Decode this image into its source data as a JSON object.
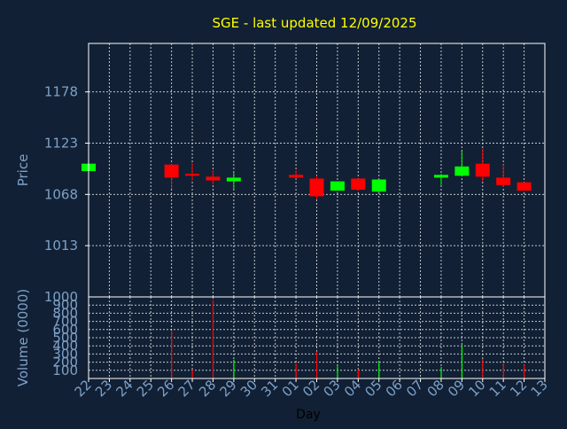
{
  "title": "SGE - last updated 12/09/2025",
  "colors": {
    "background": "#112034",
    "title": "#ffff00",
    "axis_text": "#7ea0c8",
    "xlabel": "#000000",
    "grid": "#ffffff",
    "frame": "#ffffff",
    "up": "#00ff00",
    "down": "#ff0000"
  },
  "chart_data": [
    {
      "type": "candlestick",
      "title": "SGE - last updated 12/09/2025",
      "ylabel": "Price",
      "ylim": [
        958,
        1230
      ],
      "yticks": [
        1013,
        1068,
        1123,
        1178
      ],
      "grid": true,
      "categories": [
        "22",
        "23",
        "24",
        "25",
        "26",
        "27",
        "28",
        "29",
        "30",
        "31",
        "01",
        "02",
        "03",
        "04",
        "05",
        "06",
        "07",
        "08",
        "09",
        "10",
        "11",
        "12",
        "13"
      ],
      "candles": [
        {
          "day": "22",
          "open": 1093,
          "close": 1101,
          "high": 1101,
          "low": 1093
        },
        {
          "day": "26",
          "open": 1100,
          "close": 1086,
          "high": 1101,
          "low": 1074
        },
        {
          "day": "27",
          "open": 1090,
          "close": 1089,
          "high": 1102,
          "low": 1083
        },
        {
          "day": "28",
          "open": 1087,
          "close": 1083,
          "high": 1094,
          "low": 1079
        },
        {
          "day": "29",
          "open": 1082,
          "close": 1086,
          "high": 1091,
          "low": 1074
        },
        {
          "day": "01",
          "open": 1089,
          "close": 1086,
          "high": 1094,
          "low": 1085
        },
        {
          "day": "02",
          "open": 1085,
          "close": 1066,
          "high": 1088,
          "low": 1063
        },
        {
          "day": "03",
          "open": 1072,
          "close": 1082,
          "high": 1082,
          "low": 1072
        },
        {
          "day": "04",
          "open": 1085,
          "close": 1073,
          "high": 1085,
          "low": 1072
        },
        {
          "day": "05",
          "open": 1071,
          "close": 1084,
          "high": 1084,
          "low": 1070
        },
        {
          "day": "08",
          "open": 1086,
          "close": 1089,
          "high": 1090,
          "low": 1078
        },
        {
          "day": "09",
          "open": 1088,
          "close": 1098,
          "high": 1114,
          "low": 1088
        },
        {
          "day": "10",
          "open": 1101,
          "close": 1087,
          "high": 1117,
          "low": 1082
        },
        {
          "day": "11",
          "open": 1086,
          "close": 1078,
          "high": 1100,
          "low": 1076
        },
        {
          "day": "12",
          "open": 1081,
          "close": 1072,
          "high": 1081,
          "low": 1072
        }
      ]
    },
    {
      "type": "bar",
      "ylabel": "Volume (0000)",
      "xlabel": "Day",
      "ylim": [
        0,
        1000
      ],
      "yticks": [
        100,
        200,
        300,
        400,
        500,
        600,
        700,
        800,
        900
      ],
      "ytick_labels": [
        "100",
        "200",
        "300",
        "400",
        "500",
        "600",
        "700",
        "800",
        "900"
      ],
      "top_label": "1000",
      "grid": true,
      "categories": [
        "22",
        "23",
        "24",
        "25",
        "26",
        "27",
        "28",
        "29",
        "30",
        "31",
        "01",
        "02",
        "03",
        "04",
        "05",
        "06",
        "07",
        "08",
        "09",
        "10",
        "11",
        "12",
        "13"
      ],
      "bars": [
        {
          "day": "26",
          "value": 580,
          "direction": "down"
        },
        {
          "day": "27",
          "value": 110,
          "direction": "down"
        },
        {
          "day": "28",
          "value": 960,
          "direction": "down"
        },
        {
          "day": "29",
          "value": 230,
          "direction": "up"
        },
        {
          "day": "01",
          "value": 190,
          "direction": "down"
        },
        {
          "day": "02",
          "value": 330,
          "direction": "down"
        },
        {
          "day": "03",
          "value": 150,
          "direction": "up"
        },
        {
          "day": "04",
          "value": 110,
          "direction": "down"
        },
        {
          "day": "05",
          "value": 210,
          "direction": "up"
        },
        {
          "day": "08",
          "value": 140,
          "direction": "up"
        },
        {
          "day": "09",
          "value": 410,
          "direction": "up"
        },
        {
          "day": "10",
          "value": 240,
          "direction": "down"
        },
        {
          "day": "11",
          "value": 190,
          "direction": "down"
        },
        {
          "day": "12",
          "value": 170,
          "direction": "down"
        }
      ]
    }
  ]
}
